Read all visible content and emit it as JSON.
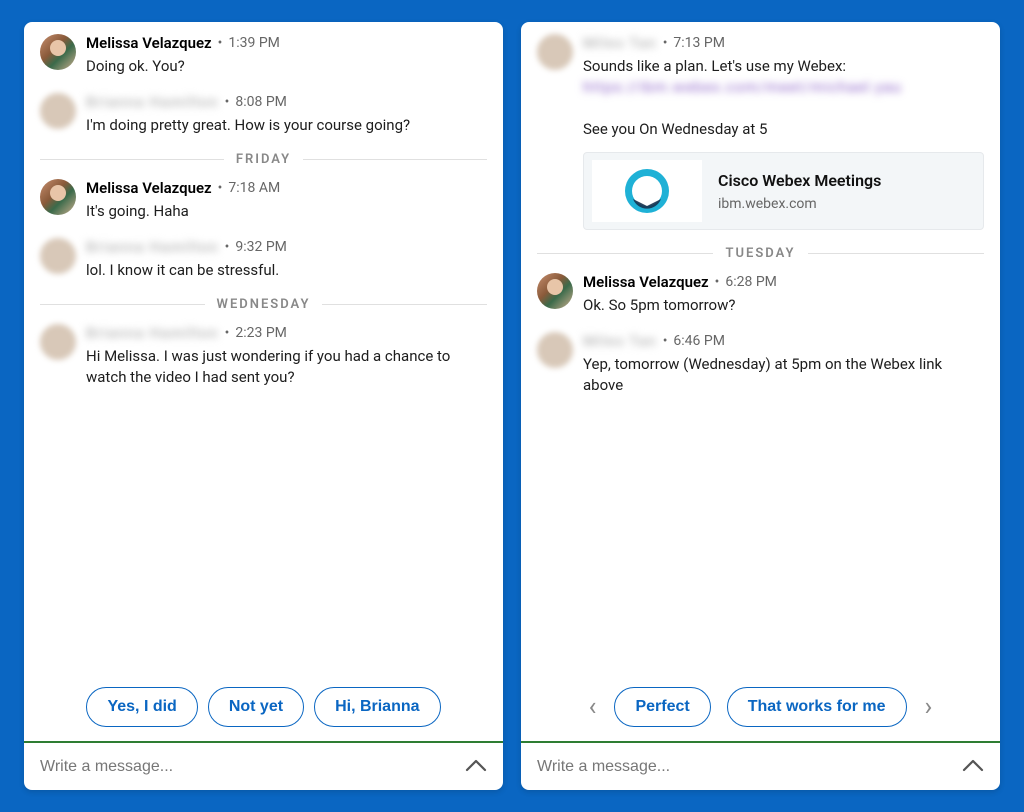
{
  "left": {
    "messages": [
      {
        "sender": "Melissa Velazquez",
        "blurred": false,
        "time": "1:39 PM",
        "text": "Doing ok. You?"
      },
      {
        "sender": "Brianna Hamilton",
        "blurred": true,
        "time": "8:08 PM",
        "text": "I'm doing pretty great. How is your course going?"
      }
    ],
    "sep1": "FRIDAY",
    "messages2": [
      {
        "sender": "Melissa Velazquez",
        "blurred": false,
        "time": "7:18 AM",
        "text": "It's going. Haha"
      },
      {
        "sender": "Brianna Hamilton",
        "blurred": true,
        "time": "9:32 PM",
        "text": "lol. I know it can be stressful."
      }
    ],
    "sep2": "WEDNESDAY",
    "messages3": [
      {
        "sender": "Brianna Hamilton",
        "blurred": true,
        "time": "2:23 PM",
        "text": "Hi Melissa. I was just wondering if you had a chance to watch the video I had sent you?"
      }
    ],
    "suggestions": [
      "Yes, I did",
      "Not yet",
      "Hi, Brianna"
    ],
    "compose_placeholder": "Write a message..."
  },
  "right": {
    "top": {
      "sender": "Miles Tan",
      "blurred": true,
      "time": "7:13 PM",
      "line1": "Sounds like a plan. Let's use my Webex:",
      "link_blur": "https://ibm.webex.com/meet/michael.yau",
      "line3": "See you On Wednesday at 5",
      "card_title": "Cisco Webex Meetings",
      "card_domain": "ibm.webex.com"
    },
    "sep": "TUESDAY",
    "messages": [
      {
        "sender": "Melissa Velazquez",
        "blurred": false,
        "time": "6:28 PM",
        "text": "Ok. So 5pm tomorrow?"
      },
      {
        "sender": "Miles Tan",
        "blurred": true,
        "time": "6:46 PM",
        "text": "Yep, tomorrow (Wednesday) at 5pm on the Webex link above"
      }
    ],
    "suggestions": [
      "Perfect",
      "That works for me"
    ],
    "compose_placeholder": "Write a message..."
  }
}
